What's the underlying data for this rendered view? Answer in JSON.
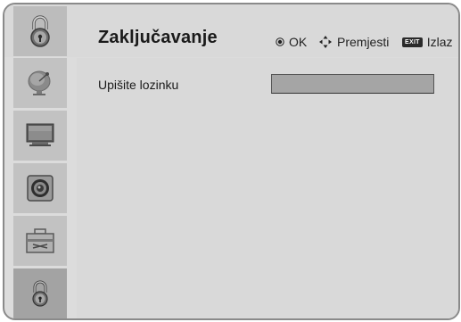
{
  "header": {
    "title": "Zaključavanje",
    "icon": "lock-icon"
  },
  "hints": {
    "ok_label": "OK",
    "move_label": "Premjesti",
    "exit_badge": "EXIT",
    "exit_label": "Izlaz"
  },
  "sidebar": {
    "items": [
      {
        "name": "satellite-dish-icon",
        "label": ""
      },
      {
        "name": "monitor-icon",
        "label": ""
      },
      {
        "name": "speaker-icon",
        "label": ""
      },
      {
        "name": "toolbox-icon",
        "label": ""
      },
      {
        "name": "lock-icon",
        "label": "",
        "active": true
      }
    ]
  },
  "main": {
    "password_label": "Upišite lozinku",
    "password_value": ""
  }
}
